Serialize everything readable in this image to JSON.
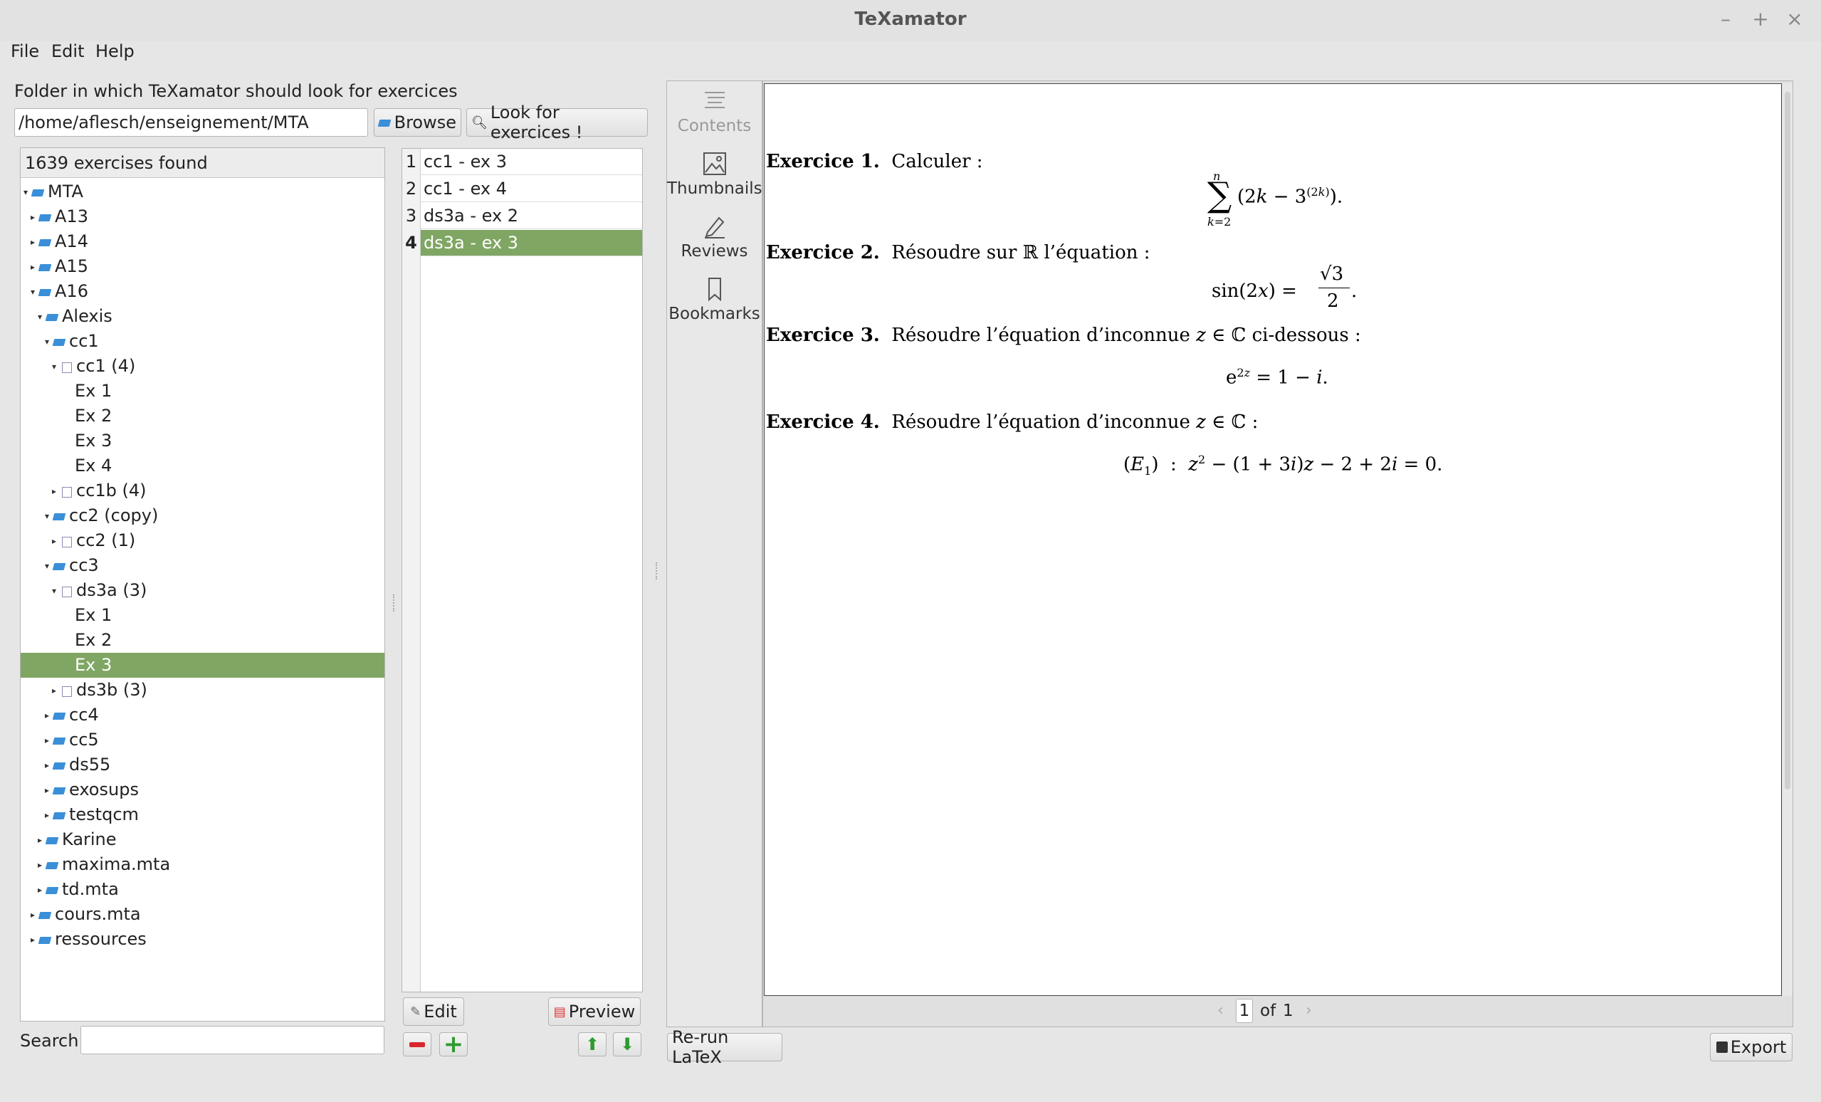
{
  "window": {
    "title": "TeXamator",
    "minimize": "–",
    "maximize": "+",
    "close": "×"
  },
  "menu": {
    "file": "File",
    "edit": "Edit",
    "help": "Help"
  },
  "folder": {
    "label": "Folder in which TeXamator should look for exercices",
    "path": "/home/aflesch/enseignement/MTA",
    "browse": "Browse",
    "look": "Look for exercices !"
  },
  "tree": {
    "header": "1639 exercises found",
    "items": [
      {
        "label": "MTA",
        "type": "folder",
        "depth": 0,
        "expanded": true
      },
      {
        "label": "A13",
        "type": "folder",
        "depth": 1,
        "expanded": false
      },
      {
        "label": "A14",
        "type": "folder",
        "depth": 1,
        "expanded": false
      },
      {
        "label": "A15",
        "type": "folder",
        "depth": 1,
        "expanded": false
      },
      {
        "label": "A16",
        "type": "folder",
        "depth": 1,
        "expanded": true
      },
      {
        "label": "Alexis",
        "type": "folder",
        "depth": 2,
        "expanded": true
      },
      {
        "label": "cc1",
        "type": "folder",
        "depth": 3,
        "expanded": true
      },
      {
        "label": "cc1 (4)",
        "type": "file",
        "depth": 4,
        "expanded": true
      },
      {
        "label": "Ex 1",
        "type": "leaf",
        "depth": 5
      },
      {
        "label": "Ex 2",
        "type": "leaf",
        "depth": 5
      },
      {
        "label": "Ex 3",
        "type": "leaf",
        "depth": 5
      },
      {
        "label": "Ex 4",
        "type": "leaf",
        "depth": 5
      },
      {
        "label": "cc1b (4)",
        "type": "file",
        "depth": 4,
        "expanded": false
      },
      {
        "label": "cc2 (copy)",
        "type": "folder",
        "depth": 3,
        "expanded": true
      },
      {
        "label": "cc2 (1)",
        "type": "file",
        "depth": 4,
        "expanded": false
      },
      {
        "label": "cc3",
        "type": "folder",
        "depth": 3,
        "expanded": true
      },
      {
        "label": "ds3a (3)",
        "type": "file",
        "depth": 4,
        "expanded": true
      },
      {
        "label": "Ex 1",
        "type": "leaf",
        "depth": 5
      },
      {
        "label": "Ex 2",
        "type": "leaf",
        "depth": 5
      },
      {
        "label": "Ex 3",
        "type": "leaf",
        "depth": 5,
        "selected": true
      },
      {
        "label": "ds3b (3)",
        "type": "file",
        "depth": 4,
        "expanded": false
      },
      {
        "label": "cc4",
        "type": "folder",
        "depth": 3,
        "expanded": false
      },
      {
        "label": "cc5",
        "type": "folder",
        "depth": 3,
        "expanded": false
      },
      {
        "label": "ds55",
        "type": "folder",
        "depth": 3,
        "expanded": false
      },
      {
        "label": "exosups",
        "type": "folder",
        "depth": 3,
        "expanded": false
      },
      {
        "label": "testqcm",
        "type": "folder",
        "depth": 3,
        "expanded": false
      },
      {
        "label": "Karine",
        "type": "folder",
        "depth": 2,
        "expanded": false
      },
      {
        "label": "maxima.mta",
        "type": "folder",
        "depth": 2,
        "expanded": false
      },
      {
        "label": "td.mta",
        "type": "folder",
        "depth": 2,
        "expanded": false
      },
      {
        "label": "cours.mta",
        "type": "folder",
        "depth": 1,
        "expanded": false
      },
      {
        "label": "ressources",
        "type": "folder",
        "depth": 1,
        "expanded": false
      }
    ]
  },
  "search": {
    "label": "Search",
    "value": ""
  },
  "selection": {
    "items": [
      {
        "num": "1",
        "label": "cc1 - ex 3"
      },
      {
        "num": "2",
        "label": "cc1 - ex 4"
      },
      {
        "num": "3",
        "label": "ds3a - ex 2"
      },
      {
        "num": "4",
        "label": "ds3a - ex 3",
        "selected": true
      }
    ],
    "edit": "Edit",
    "preview": "Preview"
  },
  "sidepanel": {
    "contents": "Contents",
    "thumbnails": "Thumbnails",
    "reviews": "Reviews",
    "bookmarks": "Bookmarks"
  },
  "document": {
    "ex1": {
      "head": "Exercice 1.",
      "text": "Calculer :"
    },
    "ex2": {
      "head": "Exercice 2.",
      "text": "Résoudre sur ℝ l’équation :"
    },
    "ex3": {
      "head": "Exercice 3.",
      "text_a": "Résoudre l’équation d’inconnue ",
      "var": "z",
      "text_b": " ∈ ℂ ci-dessous :"
    },
    "ex4": {
      "head": "Exercice 4.",
      "text_a": "Résoudre l’équation d’inconnue ",
      "var": "z",
      "text_b": " ∈ ℂ :"
    }
  },
  "pager": {
    "page": "1",
    "of": "of",
    "total": "1"
  },
  "buttons": {
    "rerun": "Re-run LaTeX",
    "export": "Export"
  },
  "colors": {
    "selection": "#7fa663",
    "folder": "#3a8fd8"
  }
}
